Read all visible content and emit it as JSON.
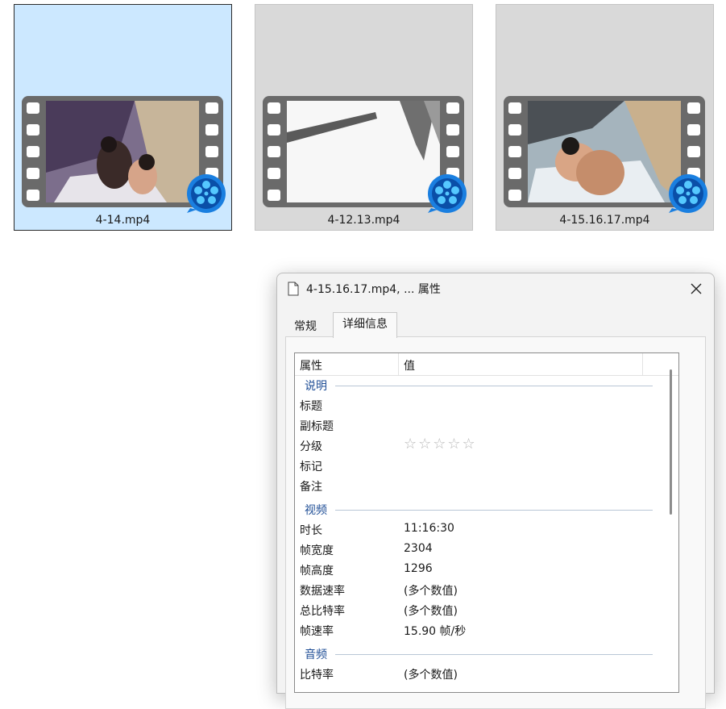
{
  "files": [
    {
      "name": "4-14.mp4",
      "selected": true
    },
    {
      "name": "4-12.13.mp4",
      "selected": false
    },
    {
      "name": "4-15.16.17.mp4",
      "selected": false
    }
  ],
  "dialog": {
    "title": "4-15.16.17.mp4, ... 属性",
    "tabs": {
      "general": "常规",
      "details": "详细信息"
    },
    "columns": {
      "property": "属性",
      "value": "值"
    },
    "groups": {
      "description": {
        "title": "说明",
        "rows": [
          {
            "key": "标题",
            "value": ""
          },
          {
            "key": "副标题",
            "value": ""
          },
          {
            "key": "分级",
            "value": "",
            "rating": 0
          },
          {
            "key": "标记",
            "value": ""
          },
          {
            "key": "备注",
            "value": ""
          }
        ]
      },
      "video": {
        "title": "视频",
        "rows": [
          {
            "key": "时长",
            "value": "11:16:30"
          },
          {
            "key": "帧宽度",
            "value": "2304"
          },
          {
            "key": "帧高度",
            "value": "1296"
          },
          {
            "key": "数据速率",
            "value": "(多个数值)"
          },
          {
            "key": "总比特率",
            "value": "(多个数值)"
          },
          {
            "key": "帧速率",
            "value": "15.90 帧/秒"
          }
        ]
      },
      "audio": {
        "title": "音频",
        "rows": [
          {
            "key": "比特率",
            "value": "(多个数值)"
          }
        ]
      }
    },
    "stars": "☆☆☆☆☆"
  },
  "colors": {
    "selected_tile": "#cce8ff",
    "tile": "#d9d9d9",
    "group_title": "#1f4e96",
    "player_blue": "#1a7fe0"
  },
  "icons": {
    "file": "document-icon",
    "close": "close-icon",
    "badge": "video-player-icon"
  }
}
